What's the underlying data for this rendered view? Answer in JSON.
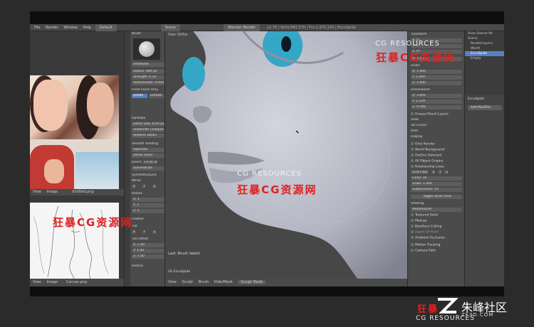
{
  "window": {
    "menu": [
      "File",
      "Render",
      "Window",
      "Help"
    ],
    "layout_field": "Default",
    "scene_field": "Scene",
    "engine_field": "Blender Render",
    "stats": "v2.78 | Verts:982,576 | Fcs:1,975,159 | Escultpido"
  },
  "refs": {
    "image_name": "Untitled.png",
    "bottom_menu": [
      "View",
      "Image",
      "Canvas.png"
    ]
  },
  "tools": {
    "section_brush": "Brush",
    "brush_name": "Inflate/De",
    "radius_label": "Radius:",
    "radius_value": "489 px",
    "strength_label": "Strength:",
    "strength_value": "0.50",
    "autosmooth_label": "Autosmooth:",
    "autosmooth_value": "0.000",
    "front_faces": "Front Faces Only",
    "mode_add": "Inflate",
    "mode_deflate": "Deflate",
    "section_dyntopo": "Dyntopo",
    "detail_size": "Detail Size: 8.00 px",
    "subdivide_collapse": "Subdivide Collapse",
    "relative_detail": "Relative Detail",
    "smooth_shading": "Smooth Shading",
    "optimize": "Optimize",
    "detail_flood": "Detail Flood",
    "direct": "Direct",
    "direct_value": "+X to -X",
    "symmetrize": "Symmetrize",
    "section_symmetry": "Symmetry/Lock",
    "mirror": "Mirror",
    "axes": [
      "X",
      "Y",
      "Z"
    ],
    "radial": "Radial:",
    "radial_values": [
      "X: 1",
      "Y: 1",
      "Z: 1"
    ],
    "feather": "Feather",
    "tile": "Tile",
    "tile_offset": "Tile Offset:",
    "tile_offset_values": [
      "X: 1.00",
      "Y: 1.00",
      "Z: 1.00"
    ],
    "section_history": "History"
  },
  "viewport": {
    "header": "User Ortho",
    "last_op": "Last: Brush Select",
    "object": "(0) Escultpido",
    "bottom_menu": [
      "View",
      "Sculpt",
      "Brush",
      "Hide/Mask"
    ],
    "mode": "Sculpt Mode"
  },
  "props": {
    "section_transform": "Transform",
    "location_rows": [
      "X: 0°",
      "Y: 0°",
      "Z: 0°"
    ],
    "rotation_mode": "XYZ Euler",
    "scale_label": "Scale:",
    "scale_rows": [
      "X: 1.000",
      "Y: 1.000",
      "Z: 1.000"
    ],
    "dimensions_label": "Dimensions:",
    "dimensions_rows": [
      "X: 3.691",
      "Y: 1.529",
      "Z: 9.448"
    ],
    "grease_pencil": "Grease Pencil Layers",
    "view": "View",
    "cursor_3d": "3D Cursor",
    "item": "Item",
    "display": "Display",
    "only_render": "Only Render",
    "world_background": "World Background",
    "outline_selected": "Outline Selected",
    "all_object_origins": "All Object Origins",
    "relationship_lines": "Relationship Lines",
    "grid_floor": "Grid Floor",
    "grid_axes": [
      "X",
      "Y",
      "Z"
    ],
    "lines": "Lines: 16",
    "scale": "Scale: 1.000",
    "subdivisions": "Subdivisions: 10",
    "toggle_quad": "Toggle Quad View",
    "shading": "Shading",
    "matcap_mode": "Multitexture",
    "textured_solid": "Textured Solid",
    "matcap": "Matcap",
    "backface_culling": "Backface Culling",
    "depth_of_field": "Depth Of Field",
    "ambient_occlusion": "Ambient Occlusion",
    "motion_tracking": "Motion Tracking",
    "camera_path": "Camera Path"
  },
  "outliner": {
    "header": [
      "View",
      "Search",
      "All"
    ],
    "items": [
      "Scene",
      "RenderLayers",
      "World",
      "Escultpido",
      "Empty"
    ],
    "selected": "Escultpido"
  },
  "modifiers": {
    "object": "Escultpido",
    "add_modifier": "Add Modifier"
  },
  "watermark": {
    "en_top": "CG RESOURCES",
    "cn_top": "狂暴CG资源网",
    "en_mid": "CG RESOURCES",
    "cn_mid": "狂暴CG资源网",
    "cn_left": "狂暴CG资源网",
    "cn_bottom": "狂暴",
    "brand_name": "朱峰社区",
    "brand_url": "ZF3D.COM",
    "en_bottom": "CG RESOURCES"
  },
  "colors": {
    "eye": "#34a7c7",
    "skin": "#b9bbc6",
    "selection": "#5680c2",
    "watermark_red": "#d22222"
  }
}
